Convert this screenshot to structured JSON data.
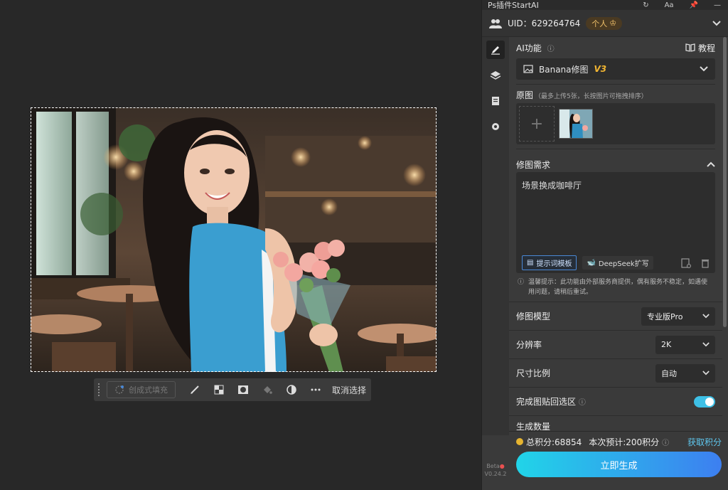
{
  "canvas": {
    "toolbar": {
      "generative_fill": "创成式填充",
      "cancel_select": "取消选择",
      "tools": [
        "brush-icon",
        "checker-icon",
        "mask-icon",
        "fill-bucket-icon",
        "invert-icon",
        "more-icon"
      ]
    }
  },
  "panel": {
    "title": "Ps插件StartAI",
    "uid_label": "UID：629264764",
    "vip_label": "个人",
    "section_ai": {
      "title": "AI功能",
      "tutorial": "教程",
      "selected_feature": "Banana修图",
      "feature_version": "V3"
    },
    "section_original": {
      "title": "原图",
      "hint": "（最多上传5张，长按图片可拖拽排序）"
    },
    "section_request": {
      "title": "修图需求",
      "text": "场景换成咖啡厅",
      "template_btn": "提示词模板",
      "deepseek_btn": "DeepSeek扩写",
      "tip": "温馨提示：此功能由外部服务商提供，偶有服务不稳定，如遇使用问题，请稍后重试。"
    },
    "settings": [
      {
        "label": "修图模型",
        "value": "专业版Pro"
      },
      {
        "label": "分辨率",
        "value": "2K"
      },
      {
        "label": "尺寸比例",
        "value": "自动"
      }
    ],
    "paste_back": {
      "label": "完成图贴回选区",
      "on": true
    },
    "gen_count_label": "生成数量",
    "footer": {
      "total_points": "总积分:68854",
      "estimate": "本次预计:200积分",
      "get_points": "获取积分",
      "generate": "立即生成"
    },
    "beta": "Beta",
    "version": "V0.24.2"
  }
}
